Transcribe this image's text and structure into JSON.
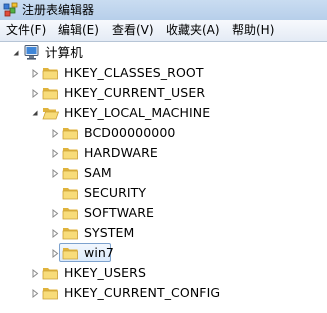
{
  "window": {
    "title": "注册表编辑器"
  },
  "menu": {
    "file": "文件(F)",
    "edit": "编辑(E)",
    "view": "查看(V)",
    "favorites": "收藏夹(A)",
    "help": "帮助(H)"
  },
  "tree": {
    "root": "计算机",
    "hives": [
      "HKEY_CLASSES_ROOT",
      "HKEY_CURRENT_USER",
      "HKEY_LOCAL_MACHINE",
      "HKEY_USERS",
      "HKEY_CURRENT_CONFIG"
    ],
    "local_machine_children": [
      "BCD00000000",
      "HARDWARE",
      "SAM",
      "SECURITY",
      "SOFTWARE",
      "SYSTEM",
      "win7"
    ],
    "selected": "win7"
  },
  "colors": {
    "folder_light": "#f8dc7a",
    "folder_dark": "#e0b33d",
    "selection_border": "#7da2ce"
  },
  "icons": {
    "app": "registry-editor-icon",
    "computer": "computer-icon",
    "folder": "folder-icon",
    "expand": "triangle-right-icon",
    "collapse": "triangle-down-icon"
  }
}
